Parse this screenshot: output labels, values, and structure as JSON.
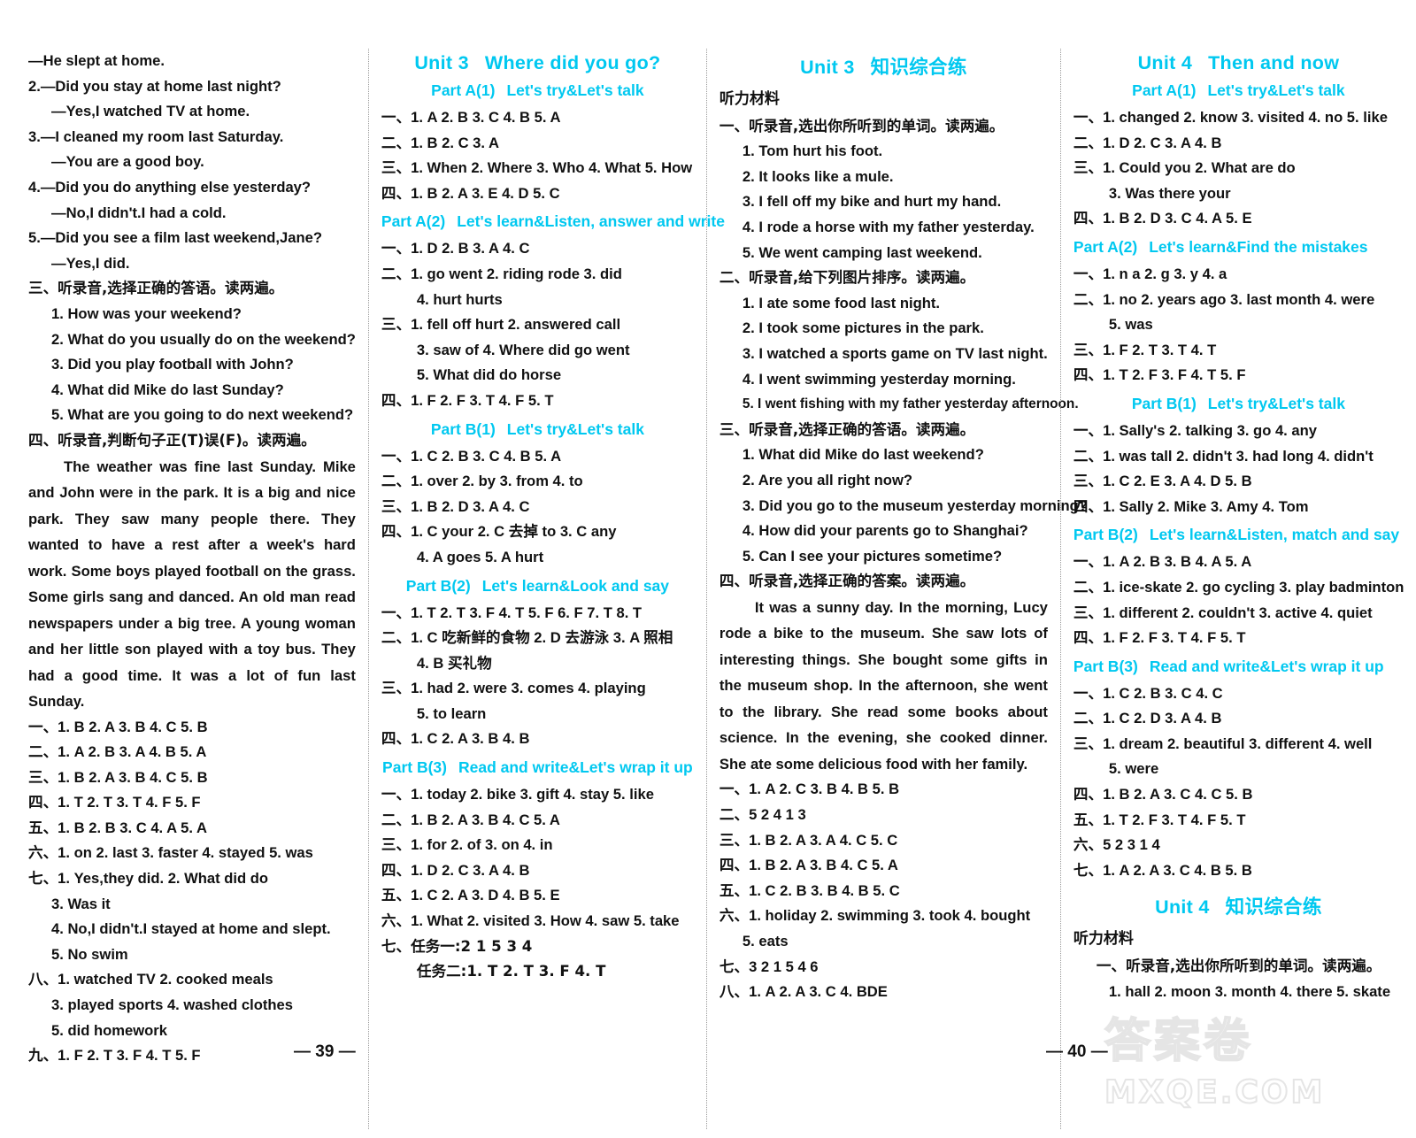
{
  "page_numbers": {
    "left": "— 39 —",
    "right": "— 40 —"
  },
  "watermark": {
    "line1": "答案卷",
    "line2": "MXQE.COM"
  },
  "col1": {
    "dialog_lines": [
      "—He slept at home.",
      "2.—Did you stay at home last night?",
      "—Yes,I watched TV at home.",
      "3.—I cleaned my room last Saturday.",
      "—You are a good boy.",
      "4.—Did you do anything else yesterday?",
      "—No,I didn't.I had a cold.",
      "5.—Did you see a film last weekend,Jane?",
      "—Yes,I did."
    ],
    "section3_title": "三、听录音,选择正确的答语。读两遍。",
    "section3_items": [
      "1. How was your weekend?",
      "2. What do you usually do on the weekend?",
      "3. Did you play football with John?",
      "4. What did Mike do last Sunday?",
      "5. What are you going to do next weekend?"
    ],
    "section4_title": "四、听录音,判断句子正(T)误(F)。读两遍。",
    "section4_passage": "The weather was fine last Sunday. Mike and John were in the park. It is a big and nice park. They saw many people there. They wanted to have a rest after a week's hard work. Some boys played football on the grass. Some girls sang and danced. An old man read newspapers under a big tree. A young woman and her little son played with a toy bus. They had a good time. It was a lot of fun last Sunday.",
    "answers": [
      "一、1. B   2. A   3. B   4. C   5. B",
      "二、1. A   2. B   3. A   4. B   5. A",
      "三、1. B   2. A   3. B   4. C   5. B",
      "四、1. T   2. T   3. T   4. F   5. F",
      "五、1. B   2. B   3. C   4. A   5. A",
      "六、1. on   2. last   3. faster   4. stayed   5. was",
      "七、1. Yes,they did.   2. What   did   do",
      "3. Was   it",
      "4. No,I didn't.I stayed at home and slept.",
      "5. No   swim",
      "八、1. watched TV   2. cooked meals",
      "3. played sports   4. washed clothes",
      "5. did homework",
      "九、1. F   2. T   3. F   4. T   5. F"
    ]
  },
  "col2": {
    "unit_title_a": "Unit 3",
    "unit_title_b": "Where did you go?",
    "parts": [
      {
        "label": "Part A(1)",
        "name": "Let's try&Let's talk",
        "center": true,
        "lines": [
          "一、1. A   2. B   3. C   4. B   5. A",
          "二、1. B   2. C   3. A",
          "三、1. When   2. Where   3. Who   4. What   5. How",
          "四、1. B   2. A   3. E   4. D   5. C"
        ]
      },
      {
        "label": "Part A(2)",
        "name": "Let's learn&Listen, answer and write",
        "center": false,
        "lines": [
          "一、1. D   2. B   3. A   4. C",
          "二、1. go   went   2. riding   rode   3. did",
          "4. hurt   hurts",
          "三、1. fell   off   hurt   2. answered   call",
          "3. saw   of   4. Where   did   go   went",
          "5. What   did   do   horse",
          "四、1. F   2. F   3. T   4. F   5. T"
        ]
      },
      {
        "label": "Part B(1)",
        "name": "Let's try&Let's talk",
        "center": true,
        "lines": [
          "一、1. C   2. B   3. C   4. B   5. A",
          "二、1. over   2. by   3. from   4. to",
          "三、1. B   2. D   3. A   4. C",
          "四、1. C   your   2. C   去掉 to   3. C   any",
          "4. A   goes   5. A   hurt"
        ]
      },
      {
        "label": "Part B(2)",
        "name": "Let's learn&Look and say",
        "center": true,
        "lines": [
          "一、1. T   2. T   3. F   4. T   5. F   6. F   7. T   8. T",
          "二、1. C   吃新鲜的食物   2. D   去游泳   3. A   照相",
          "4. B   买礼物",
          "三、1. had   2. were   3. comes   4. playing",
          "5. to learn",
          "四、1. C   2. A   3. B   4. B"
        ]
      },
      {
        "label": "Part B(3)",
        "name": "Read and write&Let's wrap it up",
        "center": true,
        "lines": [
          "一、1. today   2. bike   3. gift   4. stay   5. like",
          "二、1. B   2. A   3. B   4. C   5. A",
          "三、1. for   2. of   3. on   4. in",
          "四、1. D   2. C   3. A   4. B",
          "五、1. C   2. A   3. D   4. B   5. E",
          "六、1. What   2. visited   3. How   4. saw   5. take",
          "七、任务一:2   1   5   3   4",
          "任务二:1. T   2. T   3. F   4. T"
        ]
      }
    ]
  },
  "col3": {
    "unit_title_a": "Unit 3",
    "unit_title_b": "知识综合练",
    "listening_label": "听力材料",
    "section1_title": "一、听录音,选出你所听到的单词。读两遍。",
    "section1_items": [
      "1. Tom hurt his foot.",
      "2. It looks like a mule.",
      "3. I fell off my bike and hurt my hand.",
      "4. I rode a horse with my father yesterday.",
      "5. We went camping last weekend."
    ],
    "section2_title": "二、听录音,给下列图片排序。读两遍。",
    "section2_items": [
      "1. I ate some food last night.",
      "2. I took some pictures in the park.",
      "3. I watched a sports game on TV last night.",
      "4. I went swimming yesterday morning.",
      "5. I went fishing with my father yesterday afternoon."
    ],
    "section3_title": "三、听录音,选择正确的答语。读两遍。",
    "section3_items": [
      "1. What did Mike do last weekend?",
      "2. Are you all right now?",
      "3. Did you go to the museum yesterday morning?",
      "4. How did your parents go to Shanghai?",
      "5. Can I see your pictures sometime?"
    ],
    "section4_title": "四、听录音,选择正确的答案。读两遍。",
    "section4_passage": "It was a sunny day. In the morning, Lucy rode a bike to the museum. She saw lots of interesting things. She bought some gifts in the museum shop. In the afternoon, she went to the library. She read some books about science. In the evening, she cooked dinner. She ate some delicious food with her family.",
    "answers": [
      "一、1. A   2. C   3. B   4. B   5. B",
      "二、5  2  4  1  3",
      "三、1. B   2. A   3. A   4. C   5. C",
      "四、1. B   2. A   3. B   4. C   5. A",
      "五、1. C   2. B   3. B   4. B   5. C",
      "六、1. holiday   2. swimming   3. took   4. bought",
      "5. eats",
      "七、3  2  1  5  4  6",
      "八、1. A   2. A   3. C   4. BDE"
    ]
  },
  "col4": {
    "unit_title_a": "Unit 4",
    "unit_title_b": "Then and now",
    "parts": [
      {
        "label": "Part A(1)",
        "name": "Let's try&Let's talk",
        "center": true,
        "lines": [
          "一、1. changed   2. know   3. visited   4. no   5. like",
          "二、1. D   2. C   3. A   4. B",
          "三、1. Could   you   2. What   are   do",
          "3. Was   there   your",
          "四、1. B   2. D   3. C   4. A   5. E"
        ]
      },
      {
        "label": "Part A(2)",
        "name": "Let's learn&Find the mistakes",
        "center": false,
        "lines": [
          "一、1. n   a   2. g   3. y   4. a",
          "二、1. no   2. years ago   3. last month   4. were",
          "5. was",
          "三、1. F   2. T   3. T   4. T",
          "四、1. T   2. F   3. F   4. T   5. F"
        ]
      },
      {
        "label": "Part B(1)",
        "name": "Let's try&Let's talk",
        "center": true,
        "lines": [
          "一、1. Sally's   2. talking   3. go   4. any",
          "二、1. was   tall   2. didn't   3. had   long   4. didn't",
          "三、1. C   2. E   3. A   4. D   5. B",
          "四、1. Sally   2. Mike   3. Amy   4. Tom"
        ]
      },
      {
        "label": "Part B(2)",
        "name": "Let's learn&Listen, match and say",
        "center": false,
        "lines": [
          "一、1. A   2. B   3. B   4. A   5. A",
          "二、1. ice-skate   2. go cycling   3. play badminton",
          "三、1. different   2. couldn't   3. active   4. quiet",
          "四、1. F   2. F   3. T   4. F   5. T"
        ]
      },
      {
        "label": "Part B(3)",
        "name": "Read and write&Let's wrap it up",
        "center": false,
        "lines": [
          "一、1. C   2. B   3. C   4. C",
          "二、1. C   2. D   3. A   4. B",
          "三、1. dream   2. beautiful   3. different   4. well",
          "5. were",
          "四、1. B   2. A   3. C   4. C   5. B",
          "五、1. T   2. F   3. T   4. F   5. T",
          "六、5  2  3  1  4",
          "七、1. A   2. A   3. C   4. B   5. B"
        ]
      }
    ],
    "unit4_comp_title_a": "Unit 4",
    "unit4_comp_title_b": "知识综合练",
    "listening_label": "听力材料",
    "section1_title": "一、听录音,选出你所听到的单词。读两遍。",
    "section1_items": [
      "1. hall   2. moon   3. month   4. there   5. skate"
    ]
  }
}
